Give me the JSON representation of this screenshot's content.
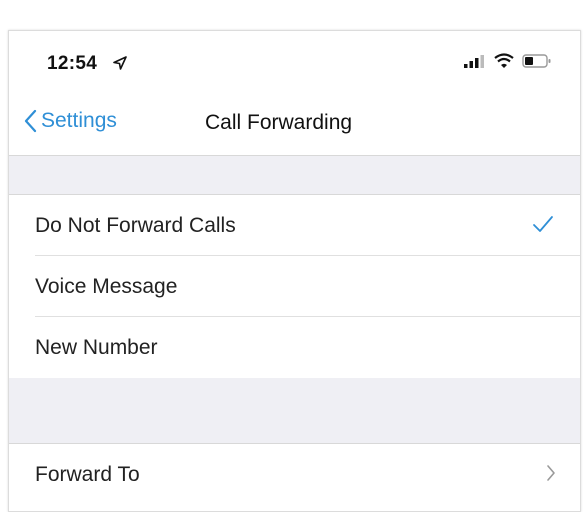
{
  "status_bar": {
    "time": "12:54",
    "icons": [
      "location-arrow-icon",
      "signal-icon",
      "wifi-icon",
      "battery-icon"
    ]
  },
  "nav": {
    "back_label": "Settings",
    "title": "Call Forwarding"
  },
  "options": [
    {
      "label": "Do Not Forward Calls",
      "selected": true
    },
    {
      "label": "Voice Message",
      "selected": false
    },
    {
      "label": "New Number",
      "selected": false
    }
  ],
  "forward_row": {
    "label": "Forward To"
  },
  "colors": {
    "accent": "#2f8fd6",
    "group_background": "#efeff4",
    "text": "#222222"
  }
}
